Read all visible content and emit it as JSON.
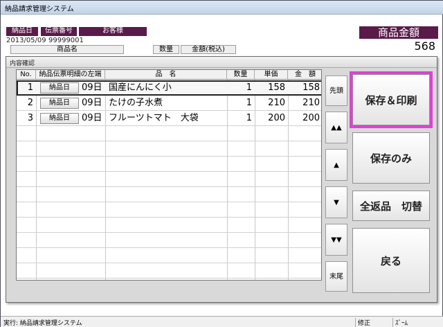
{
  "window": {
    "title": "納品請求管理システム"
  },
  "header": {
    "labels": [
      "納品日",
      "伝票番号",
      "お客様"
    ],
    "date_value": "2013/05/09",
    "slip_value": "99999001",
    "amount_label": "商品金額",
    "amount_value": "568",
    "columns": [
      "商品名",
      "数量",
      "金額(税込)"
    ]
  },
  "dialog": {
    "title": "内容確認",
    "table": {
      "headers": [
        "No.",
        "納品伝票明細の左端",
        "品　名",
        "数量",
        "単価",
        "金　額"
      ],
      "rows": [
        {
          "no": "1",
          "btn": "納品日",
          "day": "09日",
          "name": "国産にんにく小",
          "qty": "1",
          "price": "158",
          "amount": "158"
        },
        {
          "no": "2",
          "btn": "納品日",
          "day": "09日",
          "name": "たけの子水煮",
          "qty": "1",
          "price": "210",
          "amount": "210"
        },
        {
          "no": "3",
          "btn": "納品日",
          "day": "09日",
          "name": "フルーツトマト　大袋",
          "qty": "1",
          "price": "200",
          "amount": "200"
        }
      ]
    },
    "nav": {
      "first": "先頭",
      "page_up": "▲▲",
      "up": "▲",
      "down": "▼",
      "page_down": "▼▼",
      "last": "末尾"
    },
    "actions": {
      "save_print": "保存＆印刷",
      "save_only": "保存のみ",
      "toggle_return": "全返品　切替",
      "back": "戻る"
    }
  },
  "status": {
    "left": "実行: 納品請求管理システム",
    "mode": "修正",
    "zoom": "ｽﾞｰﾑ"
  },
  "colors": {
    "header_bg": "#5a1a4a",
    "focus_outline": "#e040d8"
  }
}
